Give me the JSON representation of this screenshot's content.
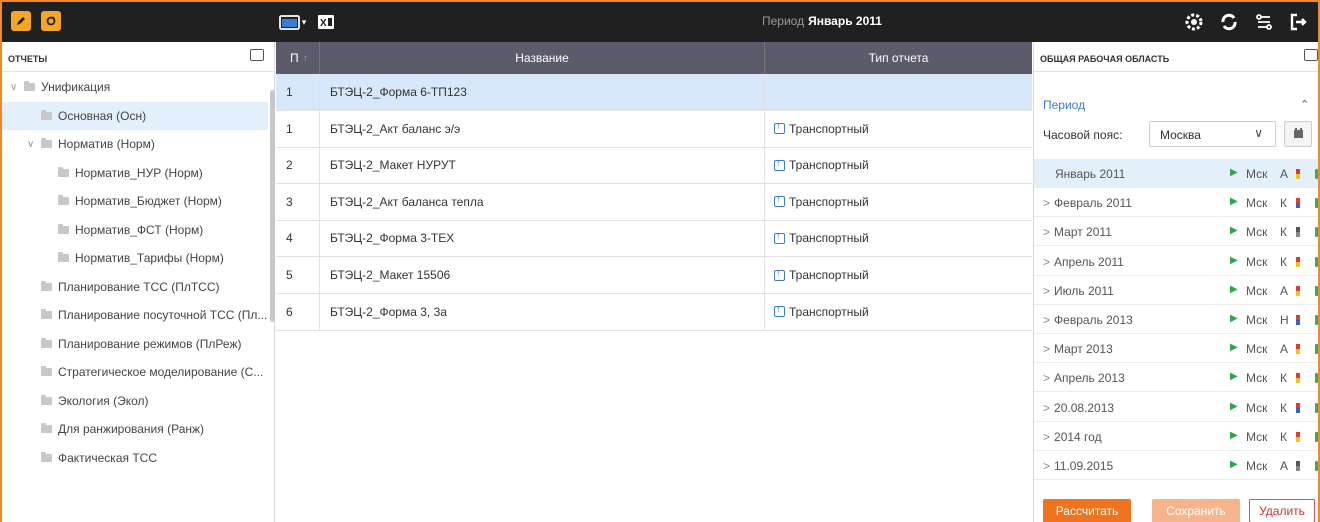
{
  "header": {
    "period_label": "Период",
    "period_value": "Январь 2011"
  },
  "colors": {
    "accent": "#f5a623",
    "selected": "#e3effb",
    "link": "#3a7bd5",
    "primary_button": "#f0731f"
  },
  "left_panel": {
    "title": "ОТЧЕТЫ",
    "tree": [
      {
        "label": "Унификация",
        "level": 0,
        "expanded": true
      },
      {
        "label": "Основная (Осн)",
        "level": 1,
        "selected": true
      },
      {
        "label": "Норматив (Норм)",
        "level": 1,
        "expanded": true
      },
      {
        "label": "Норматив_НУР (Норм)",
        "level": 2
      },
      {
        "label": "Норматив_Бюджет (Норм)",
        "level": 2
      },
      {
        "label": "Норматив_ФСТ (Норм)",
        "level": 2
      },
      {
        "label": "Норматив_Тарифы (Норм)",
        "level": 2
      },
      {
        "label": "Планирование ТСС (ПлТСС)",
        "level": 1
      },
      {
        "label": "Планирование посуточной ТСС (Пл...",
        "level": 1
      },
      {
        "label": "Планирование режимов (ПлРеж)",
        "level": 1
      },
      {
        "label": "Стратегическое моделирование (С...",
        "level": 1
      },
      {
        "label": "Экология (Экол)",
        "level": 1
      },
      {
        "label": "Для ранжирования (Ранж)",
        "level": 1
      },
      {
        "label": "Фактическая ТСС",
        "level": 1
      }
    ]
  },
  "table": {
    "columns": [
      "П",
      "Название",
      "Тип отчета"
    ],
    "rows": [
      {
        "n": "1",
        "name": "БТЭЦ-2_Форма 6-ТП123",
        "type": "",
        "selected": true
      },
      {
        "n": "1",
        "name": "БТЭЦ-2_Акт баланс э/э",
        "type": "Транспортный"
      },
      {
        "n": "2",
        "name": "БТЭЦ-2_Макет НУРУТ",
        "type": "Транспортный"
      },
      {
        "n": "3",
        "name": "БТЭЦ-2_Акт баланса тепла",
        "type": "Транспортный"
      },
      {
        "n": "4",
        "name": "БТЭЦ-2_Форма 3-ТЕХ",
        "type": "Транспортный"
      },
      {
        "n": "5",
        "name": "БТЭЦ-2_Макет 15506",
        "type": "Транспортный"
      },
      {
        "n": "6",
        "name": "БТЭЦ-2_Форма 3, 3а",
        "type": "Транспортный"
      }
    ]
  },
  "right_panel": {
    "title": "ОБЩАЯ РАБОЧАЯ ОБЛАСТЬ",
    "period_link": "Период",
    "timezone_label": "Часовой пояс:",
    "timezone_value": "Москва",
    "periods": [
      {
        "label": "Январь 2011",
        "tz": "Мск",
        "letter": "А",
        "flag": "red-yellow",
        "selected": true,
        "arrow": false
      },
      {
        "label": "Февраль 2011",
        "tz": "Мск",
        "letter": "К",
        "flag": "red-blue",
        "arrow": true
      },
      {
        "label": "Март 2011",
        "tz": "Мск",
        "letter": "К",
        "flag": "gray",
        "arrow": true
      },
      {
        "label": "Апрель 2011",
        "tz": "Мск",
        "letter": "К",
        "flag": "red-yellow",
        "arrow": true
      },
      {
        "label": "Июль 2011",
        "tz": "Мск",
        "letter": "А",
        "flag": "red-yellow",
        "arrow": true
      },
      {
        "label": "Февраль 2013",
        "tz": "Мск",
        "letter": "Н",
        "flag": "red-blue",
        "arrow": true
      },
      {
        "label": "Март 2013",
        "tz": "Мск",
        "letter": "А",
        "flag": "red-yellow",
        "arrow": true
      },
      {
        "label": "Апрель 2013",
        "tz": "Мск",
        "letter": "К",
        "flag": "red-yellow",
        "arrow": true
      },
      {
        "label": "20.08.2013",
        "tz": "Мск",
        "letter": "К",
        "flag": "red-blue",
        "arrow": true
      },
      {
        "label": "2014 год",
        "tz": "Мск",
        "letter": "К",
        "flag": "red-yellow",
        "arrow": true
      },
      {
        "label": "11.09.2015",
        "tz": "Мск",
        "letter": "А",
        "flag": "gray",
        "arrow": true
      }
    ],
    "buttons": {
      "calculate": "Рассчитать",
      "save": "Сохранить",
      "delete": "Удалить"
    }
  }
}
